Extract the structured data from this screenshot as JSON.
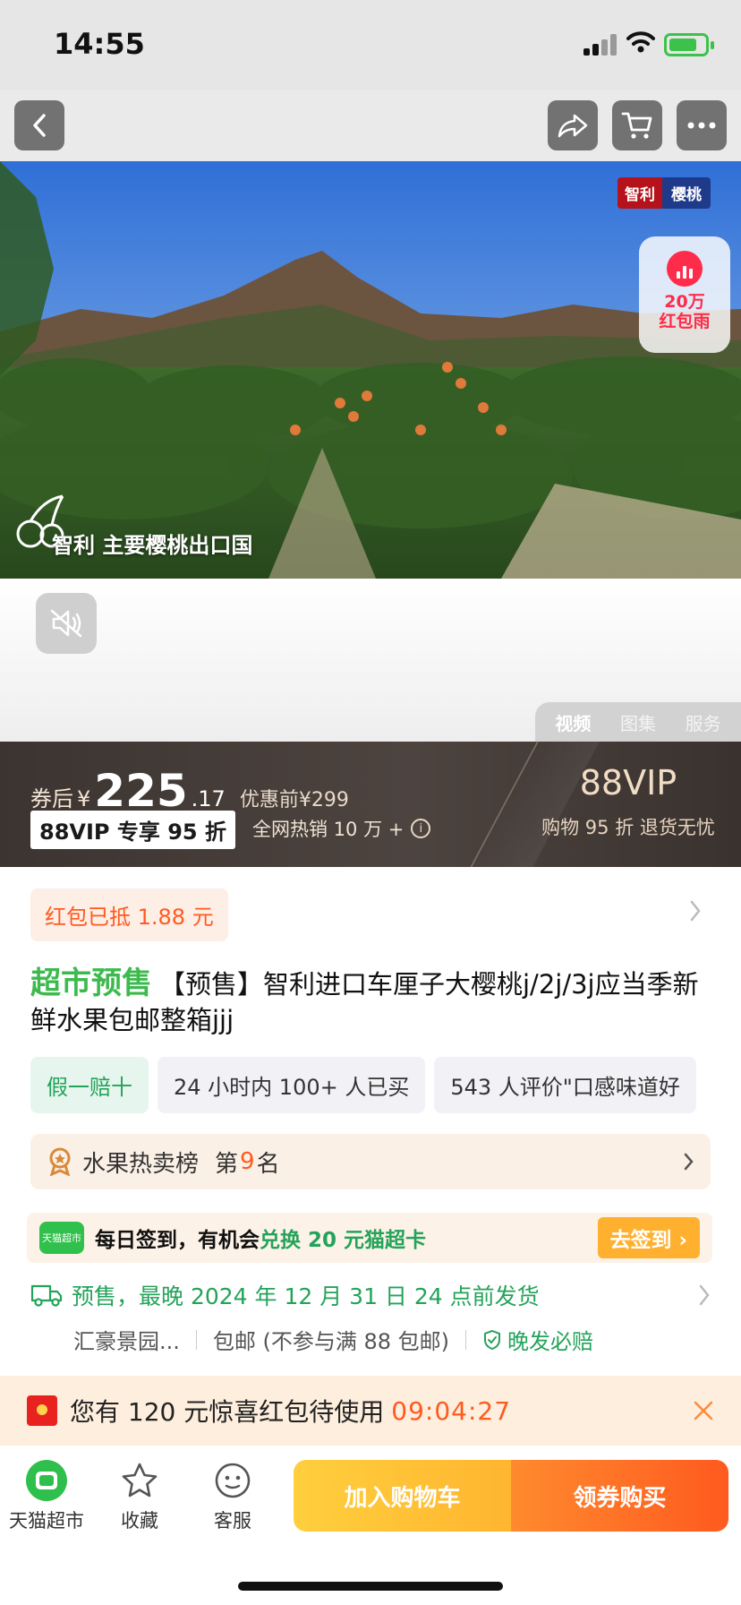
{
  "status_bar": {
    "time": "14:55"
  },
  "hero": {
    "badge_left": "智利",
    "badge_right": "樱桃",
    "red_rain_line1": "20万",
    "red_rain_line2": "红包雨",
    "caption": "智利 主要樱桃出口国"
  },
  "media_tabs": [
    "视频",
    "图集",
    "服务"
  ],
  "price": {
    "coupon_prefix": "券后",
    "currency": "¥",
    "integer": "225",
    "decimal": ".17",
    "original": "优惠前¥299",
    "vip_discount": "88VIP 专享 95 折",
    "hot_sales": "全网热销 10 万 +",
    "vip_title": "88VIP",
    "vip_sub": "购物 95 折 退货无忧"
  },
  "red_packet": "红包已抵 1.88 元",
  "product": {
    "tag": "超市预售",
    "title": "【预售】智利进口车厘子大樱桃j/2j/3j应当季新鲜水果包邮整箱jjj"
  },
  "chips": [
    "假一赔十",
    "24 小时内 100+ 人已买",
    "543 人评价\"口感味道好"
  ],
  "ranking": {
    "label": "水果热卖榜",
    "prefix": "第",
    "number": "9",
    "suffix": "名"
  },
  "checkin": {
    "logo": "天猫超市",
    "text_prefix": "每日签到，有机会",
    "text_highlight": "兑换 20 元猫超卡",
    "button": "去签到 ›"
  },
  "shipping": {
    "line1": "预售，最晚 2024 年 12 月 31 日 24 点前发货",
    "origin": "汇豪景园...",
    "postage": "包邮 (不参与满 88 包邮)",
    "assurance": "晚发必赔"
  },
  "bonus": {
    "text": "您有 120 元惊喜红包待使用",
    "timer": "09:04:27"
  },
  "bottom_bar": {
    "store": "天猫超市",
    "favorite": "收藏",
    "service": "客服",
    "add_to_cart": "加入购物车",
    "buy": "领券购买"
  },
  "colors": {
    "accent_green": "#24a35a",
    "accent_orange": "#ff5a1f",
    "cta_yellow": "#ffb530"
  }
}
